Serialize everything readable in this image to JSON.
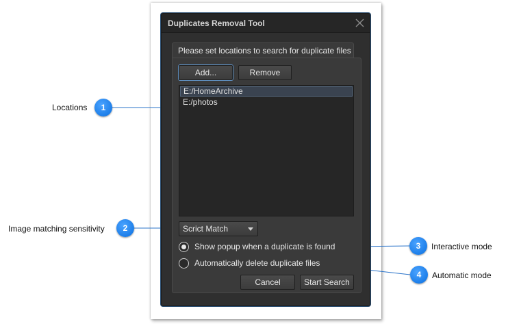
{
  "dialog": {
    "title": "Duplicates Removal Tool",
    "tab_label": "Please set locations to search for duplicate files",
    "add_button": "Add...",
    "remove_button": "Remove",
    "locations": [
      "E:/HomeArchive",
      "E:/photos"
    ],
    "sensitivity_value": "Scrict Match",
    "radio_options": [
      {
        "label": "Show popup when a duplicate is found",
        "checked": true
      },
      {
        "label": "Automatically delete duplicate files",
        "checked": false
      }
    ],
    "cancel_button": "Cancel",
    "start_button": "Start Search"
  },
  "callouts": [
    {
      "number": "1",
      "label": "Locations"
    },
    {
      "number": "2",
      "label": "Image matching sensitivity"
    },
    {
      "number": "3",
      "label": "Interactive mode"
    },
    {
      "number": "4",
      "label": "Automatic mode"
    }
  ],
  "colors": {
    "callout_blue": "#0a6fe0",
    "leader_line": "#2a73c9",
    "dialog_bg": "#2f2f2f"
  },
  "icons": {
    "close": "close-icon",
    "dropdown": "chevron-down-icon"
  }
}
